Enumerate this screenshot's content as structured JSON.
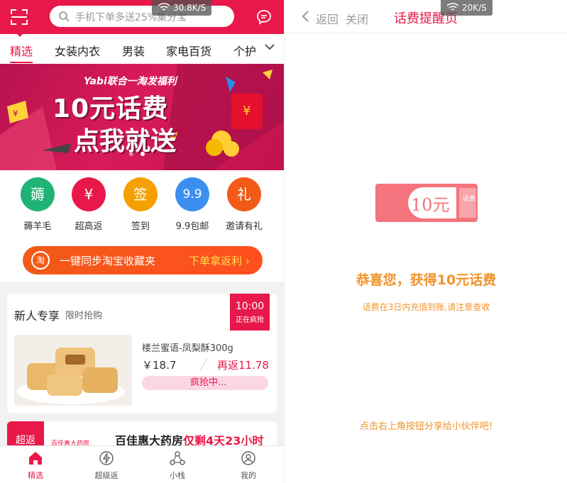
{
  "left": {
    "status_speed": "30.8K/S",
    "search": {
      "placeholder": "手机下单多送25%集分宝"
    },
    "tabs": [
      "精选",
      "女装内衣",
      "男装",
      "家电百货",
      "个护"
    ],
    "banner": {
      "subtitle": "Yabi联合一淘发福利",
      "line1": "10元话费",
      "line2": "点我就送",
      "badge": "¥"
    },
    "quick_icons": [
      {
        "glyph": "薅",
        "label": "薅羊毛",
        "color": "#1fb375"
      },
      {
        "glyph": "¥",
        "label": "超高返",
        "color": "#e8194a"
      },
      {
        "glyph": "签",
        "label": "签到",
        "color": "#f5a000"
      },
      {
        "glyph": "9.9",
        "label": "9.9包邮",
        "color": "#3b8ff0"
      },
      {
        "glyph": "礼",
        "label": "邀请有礼",
        "color": "#f25a18"
      }
    ],
    "sync": {
      "icon_text": "淘",
      "text": "一键同步淘宝收藏夹",
      "link": "下单拿返利"
    },
    "newuser": {
      "title": "新人专享",
      "subtitle": "限时抢购",
      "time": "10:00",
      "status": "正在疯抢",
      "product_name": "楼兰蜜语-凤梨酥300g",
      "price": "￥18.7",
      "rebate": "再返11.78",
      "grab": "疯抢中..."
    },
    "promo": {
      "badge": "超返",
      "logo": "百佳惠大药房",
      "store": "百佳惠大药房",
      "highlight": "仅剩4天23小时"
    },
    "bottom_nav": [
      "精选",
      "超级返",
      "小栈",
      "我的"
    ]
  },
  "right": {
    "status_speed": "20K/S",
    "back": "返回",
    "close": "关闭",
    "title": "话费提醒页",
    "coupon_value": "10元",
    "coupon_tag": "话费",
    "congrats": "恭喜您，获得10元话费",
    "notice": "话费在3日内充值到账,请注意查收",
    "share": "点击右上角按钮分享给小伙伴吧!"
  },
  "colors": {
    "brand": "#e8194a",
    "orange": "#f25a18",
    "gold": "#f0932b"
  }
}
